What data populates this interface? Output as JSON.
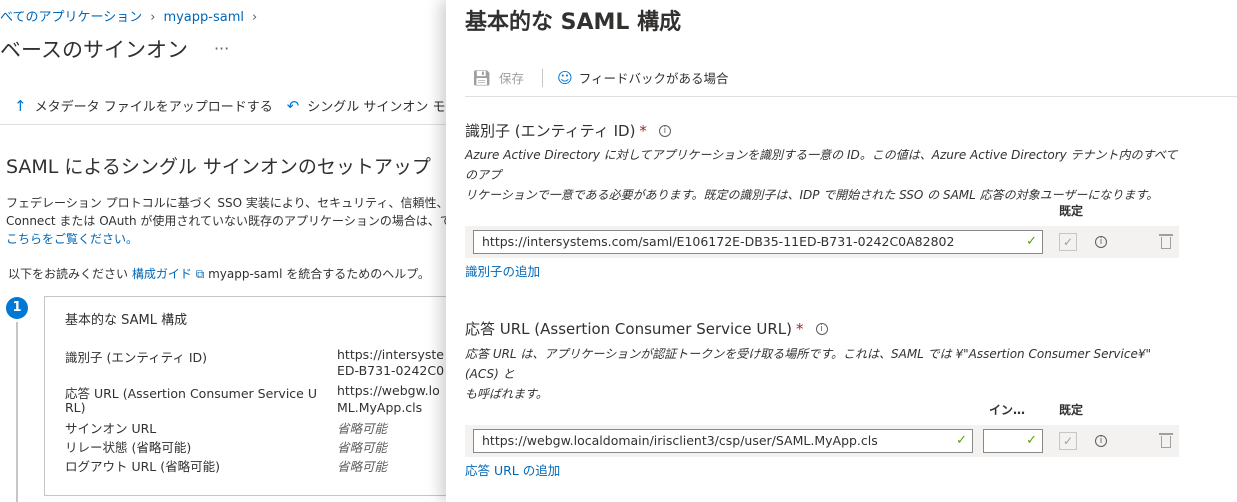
{
  "background": {
    "breadcrumb": [
      "べてのアプリケーション",
      "myapp-saml"
    ],
    "page_title": "ベースのサインオン",
    "more_label": "···",
    "toolbar": [
      {
        "label": "メタデータ ファイルをアップロードする",
        "icon": "upload-icon"
      },
      {
        "label": "シングル サインオン モードの変更",
        "icon": "undo-icon"
      }
    ],
    "section_title": "SAML によるシングル サインオンのセットアップ",
    "description_lines": [
      "フェデレーション プロトコルに基づく SSO 実装により、セキュリティ、信頼性、エンド ユーザ",
      "Connect または OAuth が使用されていない既存のアプリケーションの場合は、できるだ"
    ],
    "description_link": "こちらをご覧ください。",
    "readme_prefix": "以下をお読みください",
    "readme_link": "構成ガイド",
    "readme_suffix": "myapp-saml を統合するためのヘルプ。",
    "step_number": "1",
    "card": {
      "title": "基本的な SAML 構成",
      "rows": [
        {
          "label": "識別子 (エンティティ ID)",
          "value": "https://intersyste",
          "value2": "ED-B731-0242C0"
        },
        {
          "label": "応答 URL (Assertion Consumer Service U",
          "label2": "RL)",
          "value": "https://webgw.lo",
          "value2": "ML.MyApp.cls"
        },
        {
          "label": "サインオン URL",
          "value": "省略可能"
        },
        {
          "label": "リレー状態 (省略可能)",
          "value": "省略可能"
        },
        {
          "label": "ログアウト URL (省略可能)",
          "value": "省略可能"
        }
      ]
    }
  },
  "panel": {
    "title": "基本的な SAML 構成",
    "save_label": "保存",
    "feedback_label": "フィードバックがある場合",
    "identifier": {
      "label": "識別子 (エンティティ ID)",
      "required_mark": "*",
      "help_lines": [
        "Azure Active Directory に対してアプリケーションを識別する一意の ID。この値は、Azure Active Directory テナント内のすべてのアプ",
        "リケーションで一意である必要があります。既定の識別子は、IDP で開始された SSO の SAML 応答の対象ユーザーになります。"
      ],
      "default_header": "既定",
      "value": "https://intersystems.com/saml/E106172E-DB35-11ED-B731-0242C0A82802",
      "add_link": "識別子の追加"
    },
    "reply_url": {
      "label": "応答 URL (Assertion Consumer Service URL)",
      "required_mark": "*",
      "help_lines": [
        "応答 URL は、アプリケーションが認証トークンを受け取る場所です。これは、SAML では ¥\"Assertion Consumer Service¥\" (ACS) と",
        "も呼ばれます。"
      ],
      "index_header": "イン…",
      "default_header": "既定",
      "value": "https://webgw.localdomain/irisclient3/csp/user/SAML.MyApp.cls",
      "index_value": "",
      "add_link": "応答 URL の追加"
    }
  },
  "colors": {
    "accent": "#0078d4",
    "link": "#0067b8",
    "required": "#a4262c",
    "valid": "#57a300"
  }
}
